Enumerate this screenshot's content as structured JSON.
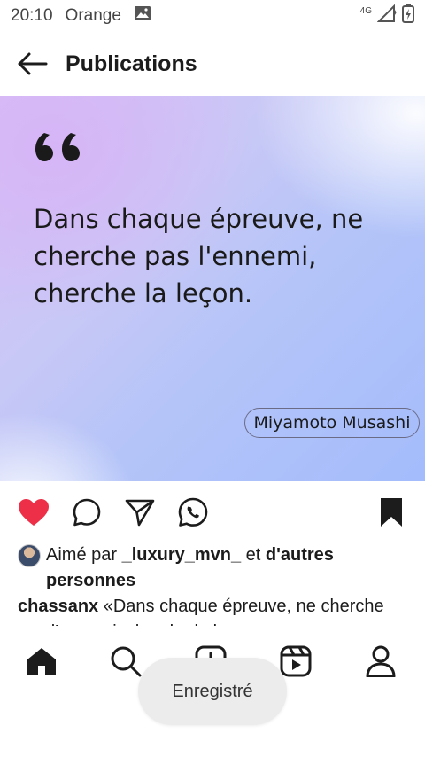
{
  "status_bar": {
    "time": "20:10",
    "carrier": "Orange",
    "network": "4G",
    "icons": [
      "image-icon",
      "signal-icon",
      "battery-charging-icon"
    ]
  },
  "header": {
    "title": "Publications",
    "back_icon": "arrow-left-icon"
  },
  "post": {
    "quote_lines": [
      "Dans chaque épreuve, ne",
      "cherche pas l'ennemi,",
      "cherche la leçon."
    ],
    "author": "Miyamoto Musashi",
    "colors": {
      "gradient_start": "#d8c0f6",
      "gradient_end": "#a4bcfc",
      "quote_mark": "#1a1a1a"
    }
  },
  "actions": {
    "like": {
      "icon": "heart-icon",
      "liked": true,
      "color": "#ed2f48"
    },
    "comment": {
      "icon": "comment-icon"
    },
    "share": {
      "icon": "send-icon"
    },
    "whatsapp": {
      "icon": "whatsapp-icon"
    },
    "save": {
      "icon": "bookmark-icon",
      "saved": true
    }
  },
  "likes": {
    "prefix": "Aimé par",
    "user": "_luxury_mvn_",
    "connector": "et",
    "others": "d'autres personnes"
  },
  "caption": {
    "username": "chassanx",
    "text": "«Dans chaque épreuve, ne cherche pas l'ennemi, cherche la leçon.»"
  },
  "bottom_nav": {
    "items": [
      {
        "name": "home",
        "icon": "home-icon",
        "active": true
      },
      {
        "name": "search",
        "icon": "search-icon"
      },
      {
        "name": "create",
        "icon": "add-post-icon"
      },
      {
        "name": "reels",
        "icon": "reels-icon"
      },
      {
        "name": "profile",
        "icon": "profile-icon"
      }
    ]
  },
  "toast": {
    "text": "Enregistré"
  }
}
